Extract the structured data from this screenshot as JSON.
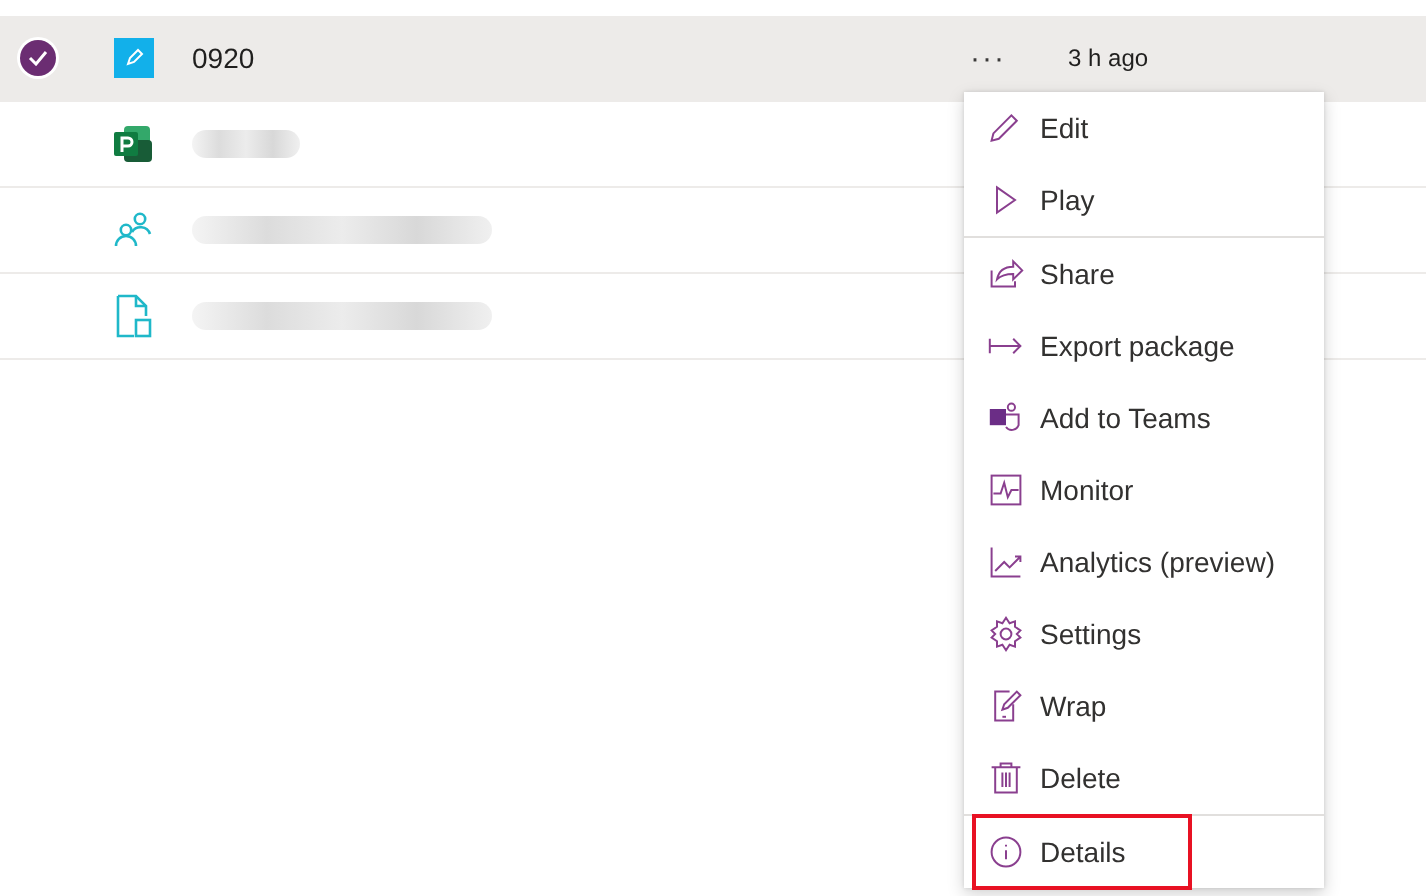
{
  "rows": [
    {
      "kind": "canvas-app",
      "name": "0920",
      "selected": true,
      "more": "···",
      "modified": "3 h ago"
    },
    {
      "kind": "project",
      "selected": false
    },
    {
      "kind": "people",
      "selected": false
    },
    {
      "kind": "document",
      "selected": false
    }
  ],
  "menu": {
    "groups": [
      [
        {
          "kind": "edit",
          "label": "Edit",
          "highlighted": false
        },
        {
          "kind": "play",
          "label": "Play",
          "highlighted": false
        }
      ],
      [
        {
          "kind": "share",
          "label": "Share",
          "highlighted": false
        },
        {
          "kind": "export",
          "label": "Export package",
          "highlighted": false
        },
        {
          "kind": "teams",
          "label": "Add to Teams",
          "highlighted": false
        },
        {
          "kind": "monitor",
          "label": "Monitor",
          "highlighted": false
        },
        {
          "kind": "analytics",
          "label": "Analytics (preview)",
          "highlighted": false
        },
        {
          "kind": "settings",
          "label": "Settings",
          "highlighted": false
        },
        {
          "kind": "wrap",
          "label": "Wrap",
          "highlighted": false
        },
        {
          "kind": "delete",
          "label": "Delete",
          "highlighted": false
        }
      ],
      [
        {
          "kind": "details",
          "label": "Details",
          "highlighted": true
        }
      ]
    ]
  }
}
